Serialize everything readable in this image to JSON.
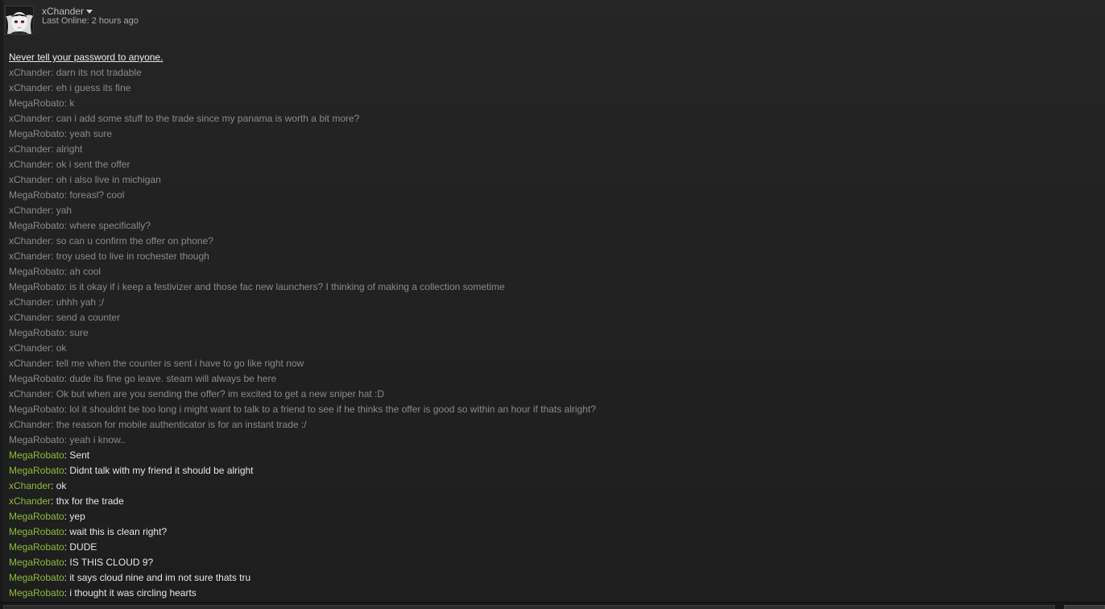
{
  "header": {
    "friend_name": "xChander",
    "status": "Last Online: 2 hours ago"
  },
  "notice": "Never tell your password to anyone.",
  "messages": [
    {
      "sender": "xChander",
      "text": "darn its not tradable",
      "state": "old"
    },
    {
      "sender": "xChander",
      "text": "eh i guess its fine",
      "state": "old"
    },
    {
      "sender": "MegaRobato",
      "text": "k",
      "state": "old"
    },
    {
      "sender": "xChander",
      "text": "can i add some stuff to the trade since my panama is worth a bit more?",
      "state": "old"
    },
    {
      "sender": "MegaRobato",
      "text": "yeah sure",
      "state": "old"
    },
    {
      "sender": "xChander",
      "text": "alright",
      "state": "old"
    },
    {
      "sender": "xChander",
      "text": "ok i sent the offer",
      "state": "old"
    },
    {
      "sender": "xChander",
      "text": "oh i also live in michigan",
      "state": "old"
    },
    {
      "sender": "MegaRobato",
      "text": "foreasl? cool",
      "state": "old"
    },
    {
      "sender": "xChander",
      "text": "yah",
      "state": "old"
    },
    {
      "sender": "MegaRobato",
      "text": "where specifically?",
      "state": "old"
    },
    {
      "sender": "xChander",
      "text": "so can u confirm the offer on phone?",
      "state": "old"
    },
    {
      "sender": "xChander",
      "text": "troy used to live in rochester though",
      "state": "old"
    },
    {
      "sender": "MegaRobato",
      "text": "ah cool",
      "state": "old"
    },
    {
      "sender": "MegaRobato",
      "text": "is it okay if i keep a festivizer and those fac new launchers? I thinking of making a collection sometime",
      "state": "old"
    },
    {
      "sender": "xChander",
      "text": "uhhh yah ;/",
      "state": "old"
    },
    {
      "sender": "xChander",
      "text": "send a counter",
      "state": "old"
    },
    {
      "sender": "MegaRobato",
      "text": "sure",
      "state": "old"
    },
    {
      "sender": "xChander",
      "text": "ok",
      "state": "old"
    },
    {
      "sender": "xChander",
      "text": "tell me when the counter is sent i have to go like right now",
      "state": "old"
    },
    {
      "sender": "MegaRobato",
      "text": "dude its fine go leave. steam will always be here",
      "state": "old"
    },
    {
      "sender": "xChander",
      "text": "Ok but when are you sending the offer? im excited to get a new sniper hat :D",
      "state": "old"
    },
    {
      "sender": "MegaRobato",
      "text": "lol it shouldnt be too long i might want to talk to a friend to see if he thinks the offer is good so within an hour if thats alright?",
      "state": "old"
    },
    {
      "sender": "xChander",
      "text": "the reason for mobile authenticator is for an instant trade :/",
      "state": "old"
    },
    {
      "sender": "MegaRobato",
      "text": "yeah i know..",
      "state": "old"
    },
    {
      "sender": "MegaRobato",
      "text": "Sent",
      "state": "new"
    },
    {
      "sender": "MegaRobato",
      "text": "Didnt talk with my friend it should be alright",
      "state": "new"
    },
    {
      "sender": "xChander",
      "text": "ok",
      "state": "new"
    },
    {
      "sender": "xChander",
      "text": "thx for the trade",
      "state": "new"
    },
    {
      "sender": "MegaRobato",
      "text": "yep",
      "state": "new"
    },
    {
      "sender": "MegaRobato",
      "text": "wait this is clean right?",
      "state": "new"
    },
    {
      "sender": "MegaRobato",
      "text": "DUDE",
      "state": "new"
    },
    {
      "sender": "MegaRobato",
      "text": "IS THIS CLOUD 9?",
      "state": "new"
    },
    {
      "sender": "MegaRobato",
      "text": "it says cloud nine and im not sure thats tru",
      "state": "new"
    },
    {
      "sender": "MegaRobato",
      "text": "i thought it was circling hearts",
      "state": "new"
    }
  ],
  "colors": {
    "background": "#212121",
    "old_text": "#8a8a8a",
    "new_sender": "#90ba3c",
    "new_text": "#e6e6e6"
  },
  "icons": {
    "avatar": "avatar-image",
    "dropdown": "chevron-down-icon"
  }
}
